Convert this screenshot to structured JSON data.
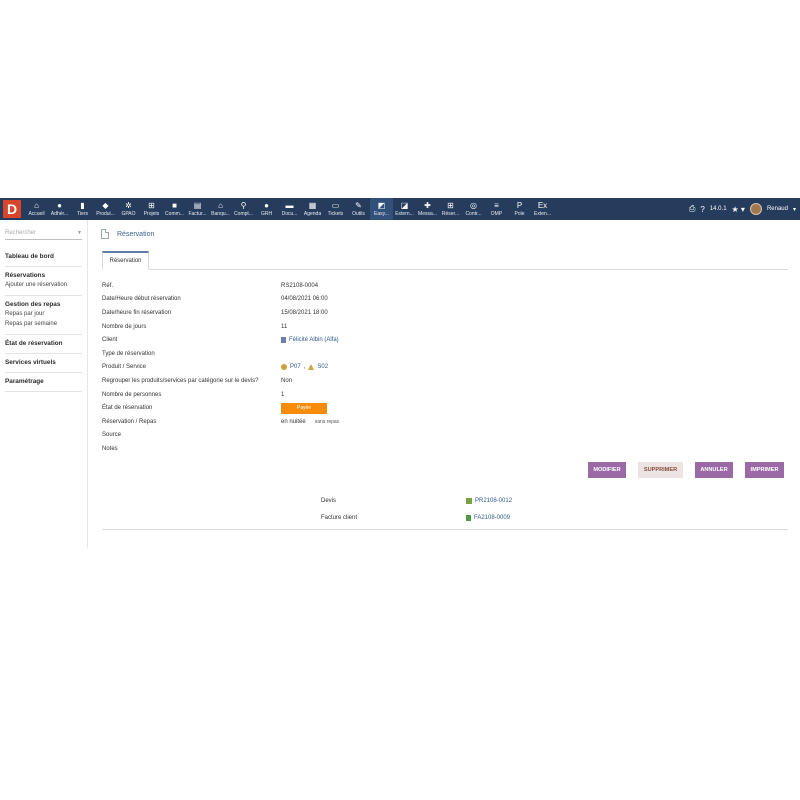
{
  "app": {
    "logo_letter": "D",
    "version": "14.0.1",
    "user_name": "Renaud"
  },
  "menu": [
    {
      "icon": "home-icon",
      "glyph": "⌂",
      "label": "Accueil"
    },
    {
      "icon": "user-icon",
      "glyph": "●",
      "label": "Adhér..."
    },
    {
      "icon": "building-icon",
      "glyph": "▮",
      "label": "Tiers"
    },
    {
      "icon": "cube-icon",
      "glyph": "◆",
      "label": "Produi..."
    },
    {
      "icon": "gear-icon",
      "glyph": "✲",
      "label": "GPAO"
    },
    {
      "icon": "sitemap-icon",
      "glyph": "⊞",
      "label": "Projets"
    },
    {
      "icon": "briefcase-icon",
      "glyph": "■",
      "label": "Comm..."
    },
    {
      "icon": "invoice-icon",
      "glyph": "▤",
      "label": "Factur..."
    },
    {
      "icon": "bank-icon",
      "glyph": "⌂",
      "label": "Banqu..."
    },
    {
      "icon": "search-dollar-icon",
      "glyph": "⚲",
      "label": "Compt..."
    },
    {
      "icon": "users-icon",
      "glyph": "●",
      "label": "GRH"
    },
    {
      "icon": "folder-icon",
      "glyph": "▬",
      "label": "Docu..."
    },
    {
      "icon": "calendar-icon",
      "glyph": "▦",
      "label": "Agenda"
    },
    {
      "icon": "ticket-icon",
      "glyph": "▭",
      "label": "Tickets"
    },
    {
      "icon": "wrench-icon",
      "glyph": "✎",
      "label": "Outils"
    },
    {
      "icon": "easya-icon",
      "glyph": "◩",
      "label": "Easy..."
    },
    {
      "icon": "external-icon",
      "glyph": "◪",
      "label": "Extern..."
    },
    {
      "icon": "slack-icon",
      "glyph": "✚",
      "label": "Messa..."
    },
    {
      "icon": "grid-icon",
      "glyph": "⊞",
      "label": "Réser..."
    },
    {
      "icon": "contract-icon",
      "glyph": "◎",
      "label": "Contr..."
    },
    {
      "icon": "list-icon",
      "glyph": "≡",
      "label": "OMP"
    },
    {
      "icon": "pole-icon",
      "glyph": "P",
      "label": "Pole"
    },
    {
      "icon": "extension-icon",
      "glyph": "Ex",
      "label": "Exten..."
    }
  ],
  "sidebar": {
    "search_placeholder": "Rechercher",
    "blocks": [
      {
        "title": "Tableau de bord",
        "links": []
      },
      {
        "title": "Réservations",
        "links": [
          "Ajouter une réservation"
        ]
      },
      {
        "title": "Gestion des repas",
        "links": [
          "Repas par jour",
          "Repas par semaine"
        ]
      },
      {
        "title": "État de réservation",
        "links": []
      },
      {
        "title": "Services virtuels",
        "links": []
      },
      {
        "title": "Paramétrage",
        "links": []
      }
    ]
  },
  "page": {
    "title": "Réservation",
    "tab": "Réservation"
  },
  "fields": {
    "ref": {
      "label": "Réf.",
      "value": "RS2108-0004"
    },
    "start": {
      "label": "Date/Heure début réservation",
      "value": "04/08/2021 06:00"
    },
    "end": {
      "label": "Date/heure fin réservation",
      "value": "15/08/2021 18:00"
    },
    "days": {
      "label": "Nombre de jours",
      "value": "11"
    },
    "client": {
      "label": "Client",
      "value": "Félicité Albin (Alfa)"
    },
    "type": {
      "label": "Type de réservation",
      "value": ""
    },
    "products": {
      "label": "Produit / Service",
      "product": "P07",
      "service": "S02"
    },
    "group": {
      "label": "Regrouper les produits/services par catégorie sur le devis?",
      "value": "Non"
    },
    "persons": {
      "label": "Nombre de personnes",
      "value": "1"
    },
    "status": {
      "label": "État de réservation",
      "value": "Payée",
      "color": "#f78c0a"
    },
    "meals": {
      "label": "Réservation / Repas",
      "value": "en nuitée",
      "note": "sans repas"
    },
    "source": {
      "label": "Source",
      "value": ""
    },
    "notes": {
      "label": "Notes",
      "value": ""
    }
  },
  "actions": {
    "modify": "MODIFIER",
    "delete": "SUPPRIMER",
    "cancel": "ANNULER",
    "print": "IMPRIMER"
  },
  "linked": {
    "devis_label": "Devis",
    "devis_value": "PR2108-0012",
    "invoice_label": "Facture client",
    "invoice_value": "FA2108-0009"
  }
}
